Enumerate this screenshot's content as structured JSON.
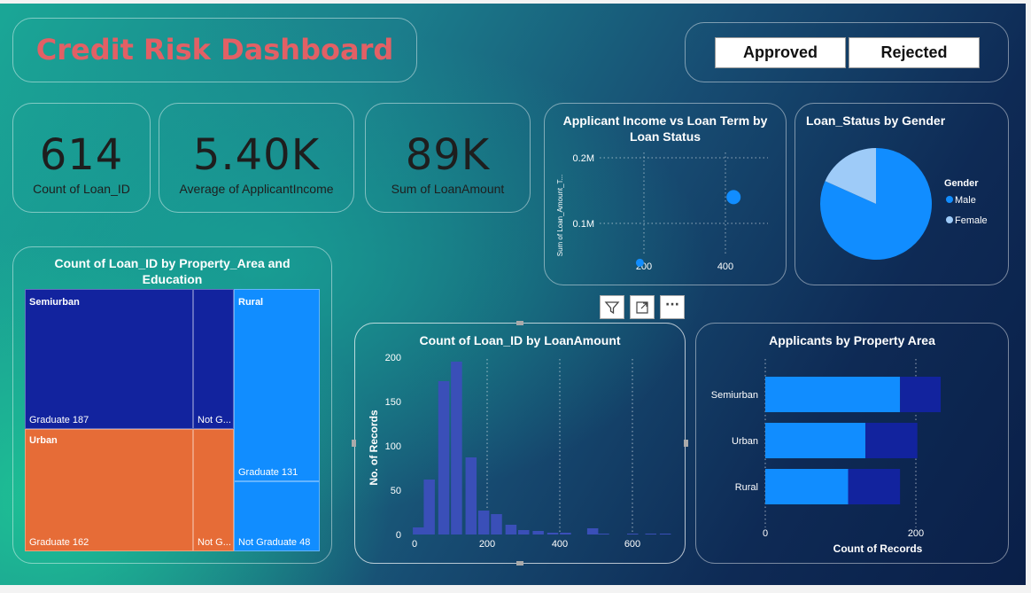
{
  "dashboard": {
    "title": "Credit Risk Dashboard"
  },
  "slicer": {
    "buttons": [
      "Approved",
      "Rejected"
    ]
  },
  "kpis": [
    {
      "value": "614",
      "label": "Count of Loan_ID"
    },
    {
      "value": "5.40K",
      "label": "Average of ApplicantIncome"
    },
    {
      "value": "89K",
      "label": "Sum of LoanAmount"
    }
  ],
  "visual_header": {
    "icons": [
      "filter-icon",
      "focus-mode-icon",
      "more-options-icon"
    ]
  },
  "chart_data": [
    {
      "type": "scatter",
      "title": "Applicant Income vs Loan Term by Loan Status",
      "xlabel": "",
      "ylabel": "Sum of Loan_Amount_T...",
      "x_ticks": [
        "200",
        "400"
      ],
      "y_ticks": [
        "0.1M",
        "0.2M"
      ],
      "points": [
        {
          "x": 190,
          "y": 0.04,
          "size": "small"
        },
        {
          "x": 420,
          "y": 0.14,
          "size": "large"
        }
      ],
      "color": "#118dff",
      "grid": true
    },
    {
      "type": "pie",
      "title": "Loan_Status by Gender",
      "legend_title": "Gender",
      "slices": [
        {
          "name": "Male",
          "value": 81.7,
          "color": "#118dff"
        },
        {
          "name": "Female",
          "value": 18.3,
          "color": "#9ecbf8"
        }
      ],
      "legend_position": "right"
    },
    {
      "type": "treemap",
      "title": "Count of Loan_ID by Property_Area and Education",
      "nodes": [
        {
          "area": "Semiurban",
          "education": "Graduate",
          "value": 187,
          "label": "Graduate 187",
          "color": "#12239e"
        },
        {
          "area": "Semiurban",
          "education": "Not Graduate",
          "value": 46,
          "label": "Not G...",
          "color": "#12239e"
        },
        {
          "area": "Urban",
          "education": "Graduate",
          "value": 162,
          "label": "Graduate 162",
          "color": "#e66c37"
        },
        {
          "area": "Urban",
          "education": "Not Graduate",
          "value": 40,
          "label": "Not G...",
          "color": "#e66c37"
        },
        {
          "area": "Rural",
          "education": "Graduate",
          "value": 131,
          "label": "Graduate 131",
          "color": "#118dff"
        },
        {
          "area": "Rural",
          "education": "Not Graduate",
          "value": 48,
          "label": "Not Graduate 48",
          "color": "#118dff"
        }
      ],
      "group_labels": [
        "Semiurban",
        "Urban",
        "Rural"
      ]
    },
    {
      "type": "bar",
      "title": "Count of Loan_ID by LoanAmount",
      "xlabel": "",
      "ylabel": "No. of Records",
      "x": [
        10,
        40,
        80,
        115,
        155,
        190,
        225,
        265,
        300,
        340,
        380,
        415,
        490,
        520,
        600,
        650,
        690
      ],
      "values": [
        8,
        62,
        173,
        195,
        87,
        27,
        23,
        11,
        5,
        4,
        2,
        2,
        7,
        1,
        1,
        1,
        1
      ],
      "x_ticks": [
        "0",
        "200",
        "400",
        "600"
      ],
      "y_ticks": [
        "0",
        "50",
        "100",
        "150",
        "200"
      ],
      "ylim": [
        0,
        210
      ],
      "color": "#3a4fb8",
      "grid": true
    },
    {
      "type": "bar",
      "orientation": "horizontal",
      "stacked": true,
      "title": "Applicants by Property Area",
      "xlabel": "Count of Records",
      "ylabel": "",
      "categories": [
        "Semiurban",
        "Urban",
        "Rural"
      ],
      "series": [
        {
          "values": [
            179,
            133,
            110
          ],
          "color": "#118dff"
        },
        {
          "values": [
            54,
            69,
            69
          ],
          "color": "#12239e"
        }
      ],
      "x_ticks": [
        "0",
        "200"
      ],
      "xlim": [
        0,
        320
      ]
    }
  ]
}
